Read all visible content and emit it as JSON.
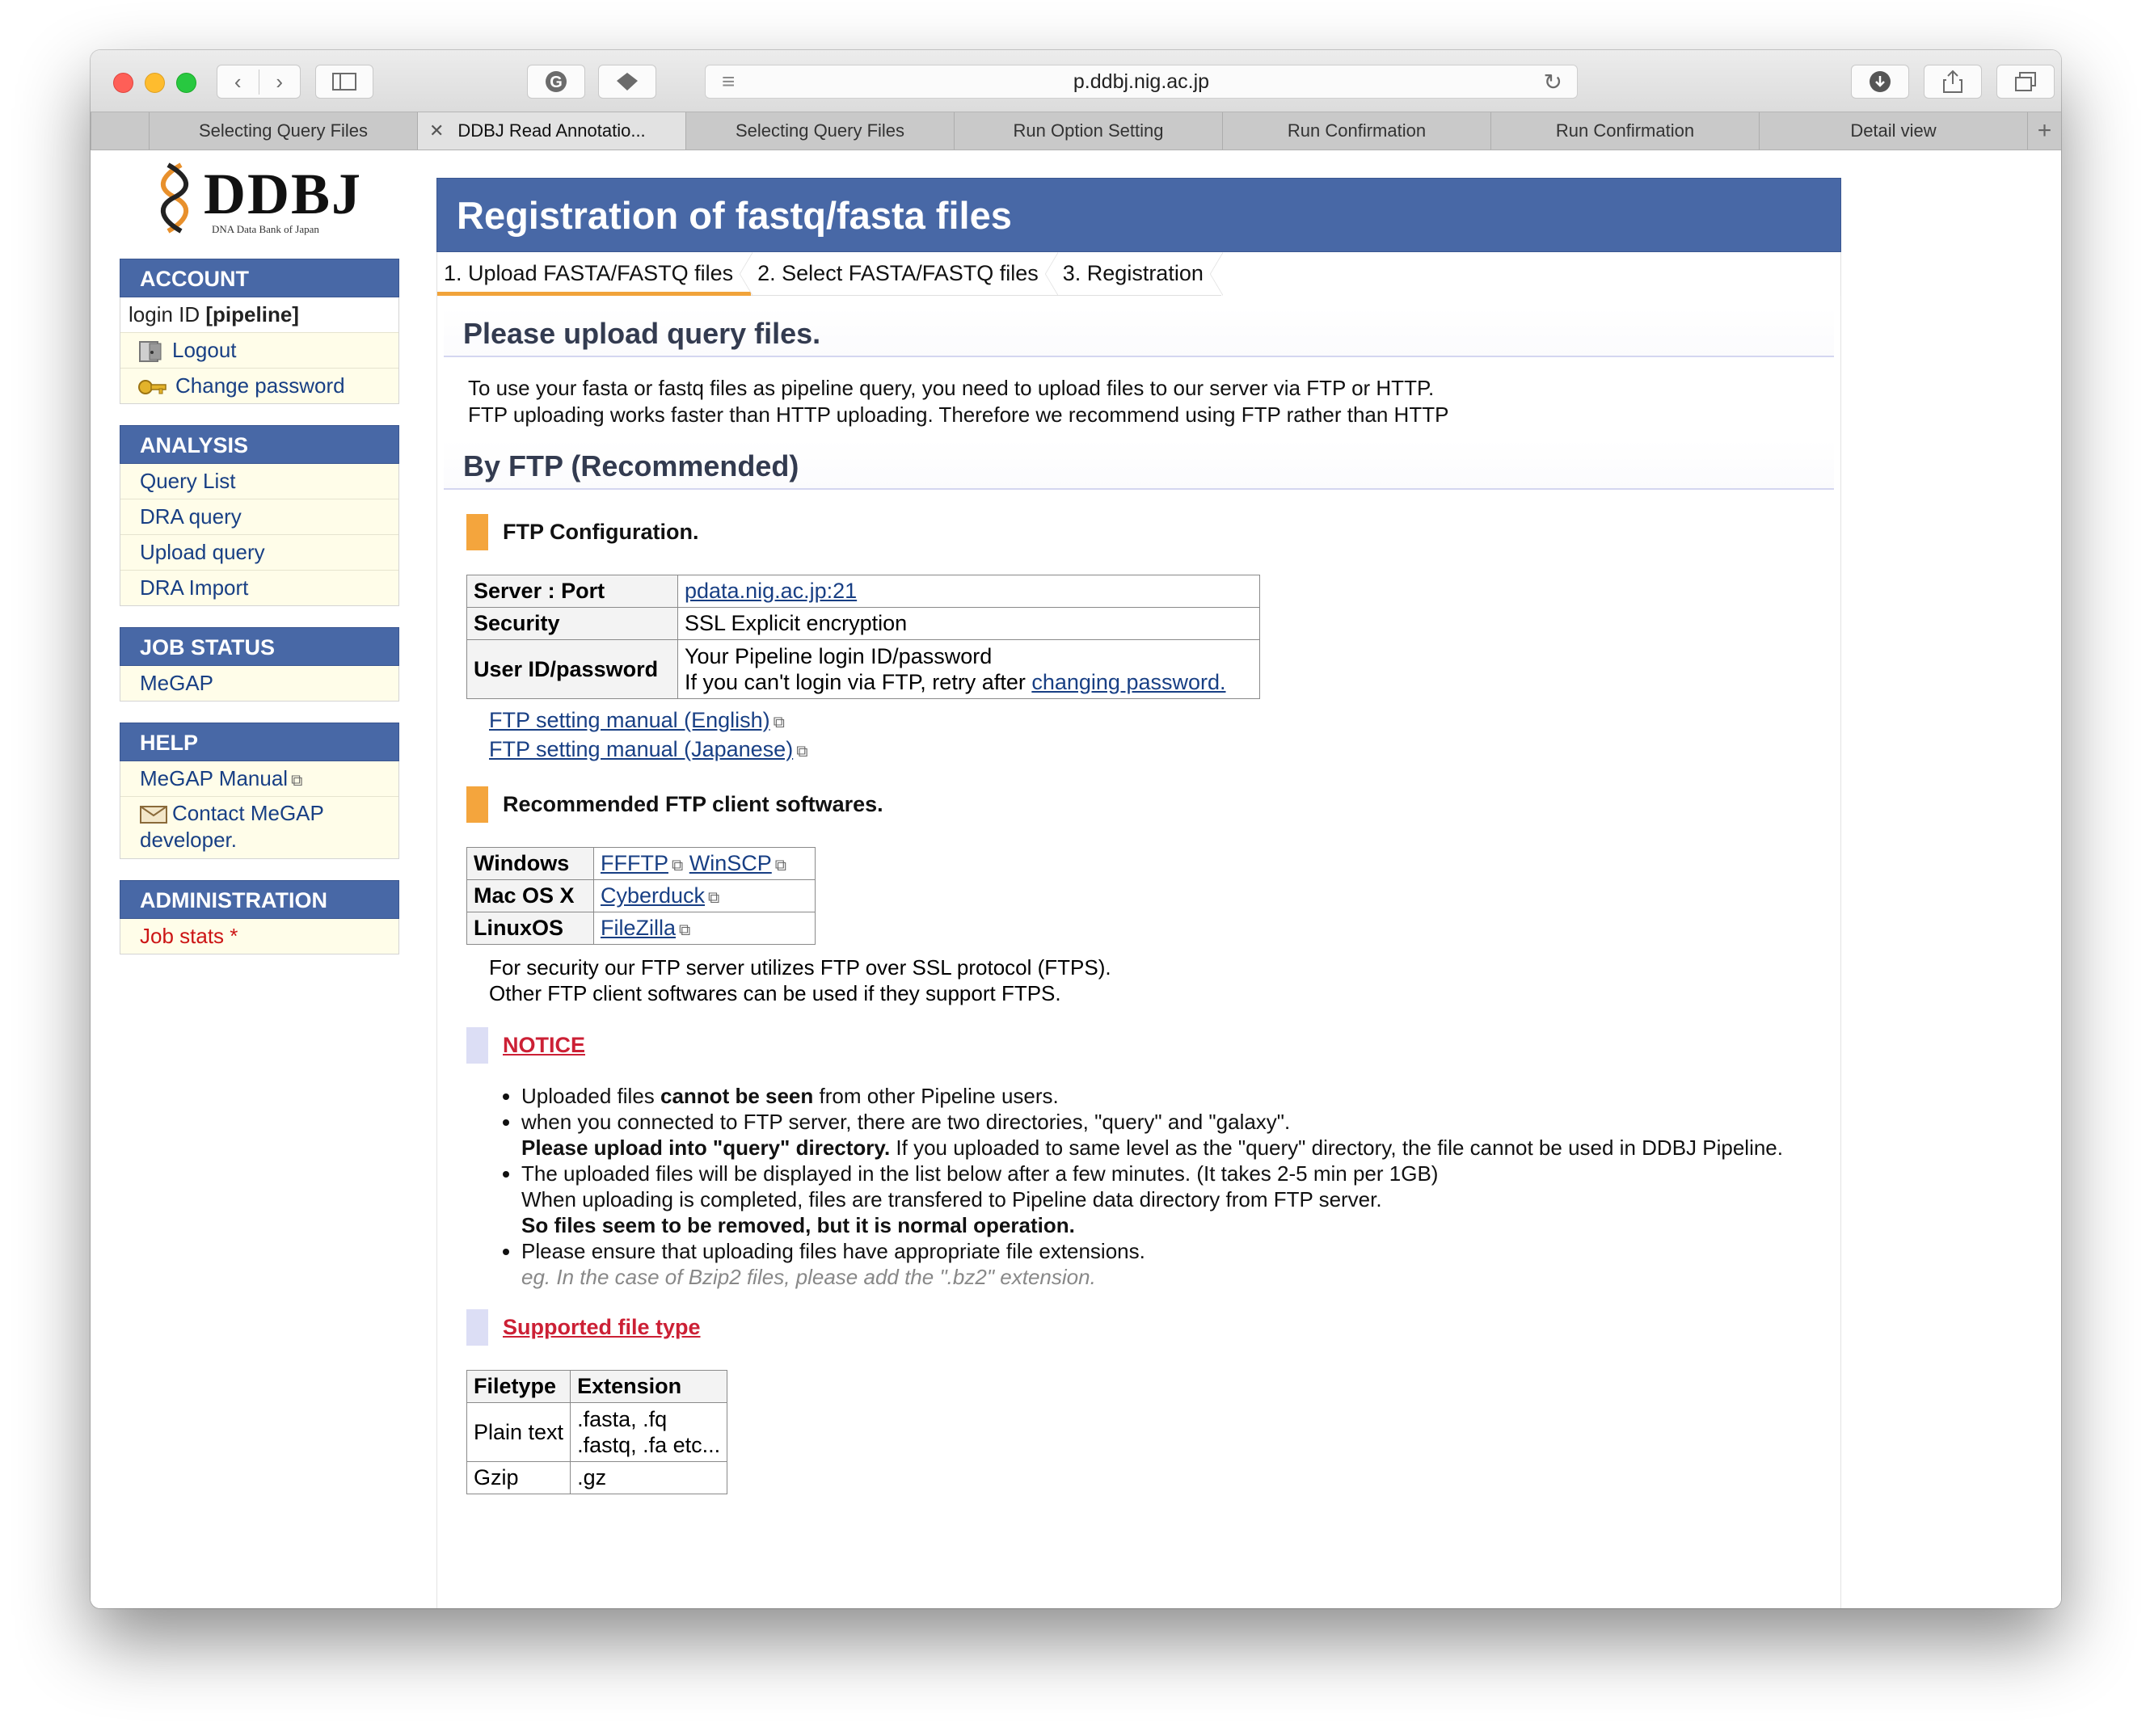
{
  "browser": {
    "url": "p.ddbj.nig.ac.jp",
    "tabs": [
      {
        "label": "Selecting Query Files"
      },
      {
        "label": "DDBJ Read Annotatio..."
      },
      {
        "label": "Selecting Query Files"
      },
      {
        "label": "Run Option Setting"
      },
      {
        "label": "Run Confirmation"
      },
      {
        "label": "Run Confirmation"
      },
      {
        "label": "Detail view"
      }
    ]
  },
  "logo": {
    "word": "DDBJ",
    "tagline": "DNA Data Bank of Japan"
  },
  "sidebar": {
    "account": {
      "heading": "ACCOUNT",
      "login_prefix": "login ID ",
      "login_id": "[pipeline]",
      "logout": "Logout",
      "change_password": "Change password"
    },
    "analysis": {
      "heading": "ANALYSIS",
      "items": [
        "Query List",
        "DRA query",
        "Upload query",
        "DRA Import"
      ]
    },
    "job_status": {
      "heading": "JOB STATUS",
      "items": [
        "MeGAP"
      ]
    },
    "help": {
      "heading": "HELP",
      "manual": "MeGAP Manual",
      "contact": "Contact MeGAP developer."
    },
    "administration": {
      "heading": "ADMINISTRATION",
      "job_stats": "Job stats *"
    }
  },
  "main": {
    "title": "Registration of fastq/fasta files",
    "steps": [
      "1. Upload FASTA/FASTQ files",
      "2. Select FASTA/FASTQ files",
      "3. Registration"
    ],
    "upload_heading": "Please upload query files.",
    "intro_line1": "To use your fasta or fastq files as pipeline query, you need to upload files to our server via FTP or HTTP.",
    "intro_line2": "FTP uploading works faster than HTTP uploading. Therefore we recommend using FTP rather than HTTP",
    "ftp_heading": "By FTP (Recommended)",
    "ftp_config": {
      "heading": "FTP Configuration.",
      "server_label": "Server : Port",
      "server_value": "pdata.nig.ac.jp:21",
      "security_label": "Security",
      "security_value": "SSL Explicit encryption",
      "userid_label": "User ID/password",
      "userid_line1": "Your Pipeline login ID/password",
      "userid_line2_prefix": "If you can't login via FTP, retry after ",
      "userid_link": "changing password."
    },
    "manual_links": [
      "FTP setting manual (English)",
      "FTP setting manual (Japanese)"
    ],
    "clients": {
      "heading": "Recommended FTP client softwares.",
      "rows": [
        {
          "os": "Windows",
          "apps": [
            "FFFTP",
            "WinSCP"
          ]
        },
        {
          "os": "Mac OS X",
          "apps": [
            "Cyberduck"
          ]
        },
        {
          "os": "LinuxOS",
          "apps": [
            "FileZilla"
          ]
        }
      ],
      "note_line1": "For security our FTP server utilizes FTP over SSL protocol (FTPS).",
      "note_line2": "Other FTP client softwares can be used if they support FTPS."
    },
    "notice": {
      "heading": "NOTICE",
      "item1_a": "Uploaded files ",
      "item1_b": "cannot be seen",
      "item1_c": " from other Pipeline users.",
      "item2_line1": "when you connected to FTP server, there are two directories, \"query\" and \"galaxy\".",
      "item2_bold": "Please upload into \"query\" directory.",
      "item2_rest": " If you uploaded to same level as the \"query\" directory, the file cannot be used in DDBJ Pipeline.",
      "item3_line1": "The uploaded files will be displayed in the list below after a few minutes. (It takes 2-5 min per 1GB)",
      "item3_line2": "When uploading is completed, files are transfered to Pipeline data directory from FTP server.",
      "item3_bold": "So files seem to be removed, but it is normal operation.",
      "item4_line1": "Please ensure that uploading files have appropriate file extensions.",
      "item4_example": "eg. In the case of Bzip2 files, please add the \".bz2\" extension."
    },
    "filetypes": {
      "heading": "Supported file type",
      "col_type": "Filetype",
      "col_ext": "Extension",
      "rows": [
        {
          "type": "Plain text",
          "ext_line1": ".fasta, .fq",
          "ext_line2": ".fastq, .fa etc..."
        },
        {
          "type": "Gzip",
          "ext_line1": ".gz",
          "ext_line2": ""
        }
      ]
    }
  },
  "colors": {
    "accent": "#4868a6",
    "orange": "#f4a53d",
    "link": "#183f84",
    "notice": "#cc2035"
  }
}
